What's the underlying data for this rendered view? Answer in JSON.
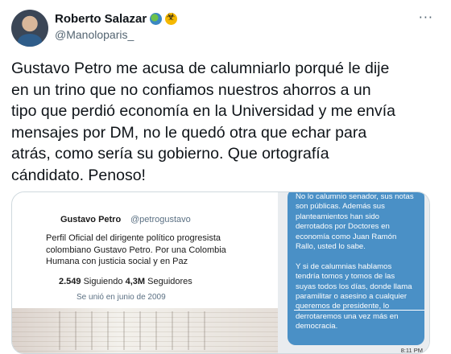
{
  "author": {
    "name": "Roberto Salazar",
    "handle": "@Manoloparis_",
    "badges": [
      "globe-icon",
      "biohazard-icon"
    ]
  },
  "menu": {
    "more_label": "···"
  },
  "tweet": {
    "text": "Gustavo Petro me acusa de calumniarlo porqué le dije\nen un trino que no confiamos nuestros ahorros a un\ntipo que perdió economía en la Universidad y me envía\nmensajes por DM, no le quedó otra que echar para\natrás, como sería su gobierno. Que ortografía\ncándidato. Penoso!"
  },
  "media": {
    "profile": {
      "name": "Gustavo Petro",
      "handle": "@petrogustavo",
      "bio": "Perfil Oficial del dirigente político progresista\ncolombiano Gustavo Petro. Por una Colombia\nHumana con justicia social y en Paz",
      "following_count": "2.549",
      "following_label": "Siguiendo",
      "followers_count": "4,3M",
      "followers_label": "Seguidores",
      "joined": "Se unió en junio de 2009"
    },
    "dm": {
      "text": "No lo calumnio senador, sus notas\nson públicas. Además sus\nplanteamientos han sido\nderrotados por Doctores en\neconomía como Juan Ramón\nRallo, usted lo sabe.\n\nY si de calumnias hablamos\ntendría tomos y tomos de las\nsuyas todos los días, donde llama\nparamilitar o asesino a cualquier\nqueremos de presidente, lo\nderrotaremos una vez más en\ndemocracia.",
      "time": "8:11 PM"
    }
  }
}
